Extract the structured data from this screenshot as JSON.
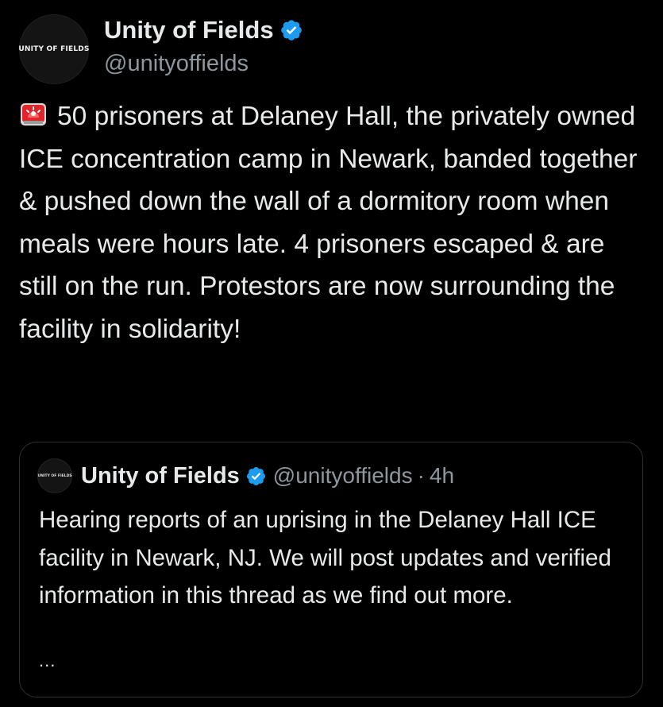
{
  "tweet": {
    "author": {
      "display_name": "Unity of Fields",
      "handle": "@unityoffields",
      "avatar_text": "UNITY OF FIELDS",
      "verified_icon": "verified-badge-icon",
      "verified_color": "#1d9bf0"
    },
    "body": {
      "lead_icon": "siren-icon",
      "text": "50 prisoners at Delaney Hall, the privately owned ICE concentration camp in Newark, banded together & pushed down the wall of a dormitory room when meals were hours late. 4 prisoners escaped & are still on the run. Protestors are now surrounding the facility in solidarity!"
    },
    "quoted": {
      "display_name": "Unity of Fields",
      "handle": "@unityoffields",
      "separator": "·",
      "time": "4h",
      "avatar_text": "UNITY OF FIELDS",
      "text": "Hearing reports of an uprising in the Delaney Hall ICE facility in Newark, NJ. We will post updates and verified information in this thread as we find out more.",
      "more": "..."
    }
  },
  "colors": {
    "background": "#000000",
    "primary_text": "#e7e9ea",
    "secondary_text": "#8f979e",
    "border": "#2d3134",
    "verified": "#1d9bf0",
    "siren": "#e0242a"
  }
}
